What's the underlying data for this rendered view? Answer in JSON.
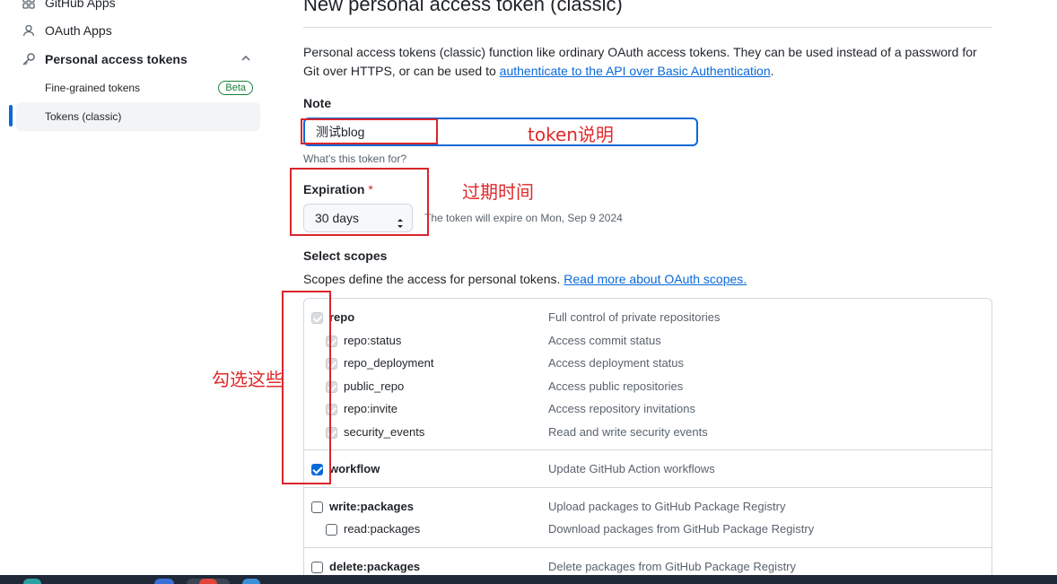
{
  "sidebar": {
    "items": [
      {
        "label": "GitHub Apps",
        "icon": "apps-grid-icon"
      },
      {
        "label": "OAuth Apps",
        "icon": "person-icon"
      },
      {
        "label": "Personal access tokens",
        "icon": "key-icon"
      }
    ],
    "subitems": [
      {
        "label": "Fine-grained tokens",
        "badge": "Beta"
      },
      {
        "label": "Tokens (classic)"
      }
    ]
  },
  "main": {
    "title": "New personal access token (classic)",
    "intro_text": "Personal access tokens (classic) function like ordinary OAuth access tokens. They can be used instead of a password for Git over HTTPS, or can be used to ",
    "intro_link": "authenticate to the API over Basic Authentication",
    "intro_end": ".",
    "note": {
      "label": "Note",
      "value": "测试blog",
      "hint": "What's this token for?"
    },
    "expiration": {
      "label": "Expiration",
      "required_mark": "*",
      "value": "30 days",
      "note": "The token will expire on Mon, Sep 9 2024"
    },
    "scopes": {
      "label": "Select scopes",
      "desc": "Scopes define the access for personal tokens. ",
      "link": "Read more about OAuth scopes.",
      "rows": [
        {
          "name": "repo",
          "desc": "Full control of private repositories",
          "state": "disabled",
          "level": 0
        },
        {
          "name": "repo:status",
          "desc": "Access commit status",
          "state": "disabled",
          "level": 1
        },
        {
          "name": "repo_deployment",
          "desc": "Access deployment status",
          "state": "disabled",
          "level": 1
        },
        {
          "name": "public_repo",
          "desc": "Access public repositories",
          "state": "disabled",
          "level": 1
        },
        {
          "name": "repo:invite",
          "desc": "Access repository invitations",
          "state": "disabled",
          "level": 1
        },
        {
          "name": "security_events",
          "desc": "Read and write security events",
          "state": "disabled",
          "level": 1
        },
        {
          "name": "workflow",
          "desc": "Update GitHub Action workflows",
          "state": "checked",
          "level": 0
        },
        {
          "name": "write:packages",
          "desc": "Upload packages to GitHub Package Registry",
          "state": "empty",
          "level": 0
        },
        {
          "name": "read:packages",
          "desc": "Download packages from GitHub Package Registry",
          "state": "empty",
          "level": 1
        },
        {
          "name": "delete:packages",
          "desc": "Delete packages from GitHub Package Registry",
          "state": "empty",
          "level": 0
        }
      ]
    }
  },
  "annotations": {
    "token_note": "token说明",
    "expiration": "过期时间",
    "check_these": "勾选这些"
  },
  "colors": {
    "accent": "#0969da",
    "annotation_red": "#e02a2a",
    "beta_green": "#1a7f37"
  }
}
